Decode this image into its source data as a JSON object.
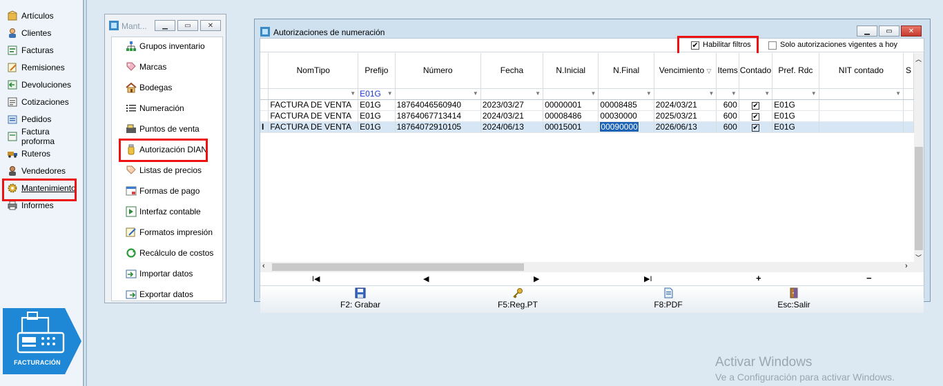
{
  "sidebar": {
    "items": [
      {
        "label": "Artículos",
        "icon": "box-icon"
      },
      {
        "label": "Clientes",
        "icon": "person-icon"
      },
      {
        "label": "Facturas",
        "icon": "invoice-icon"
      },
      {
        "label": "Remisiones",
        "icon": "note-icon"
      },
      {
        "label": "Devoluciones",
        "icon": "return-icon"
      },
      {
        "label": "Cotizaciones",
        "icon": "quote-icon"
      },
      {
        "label": "Pedidos",
        "icon": "order-icon"
      },
      {
        "label": "Factura proforma",
        "icon": "proforma-icon"
      },
      {
        "label": "Ruteros",
        "icon": "truck-icon"
      },
      {
        "label": "Vendedores",
        "icon": "seller-icon"
      },
      {
        "label": "Mantenimiento",
        "icon": "gear-icon"
      },
      {
        "label": "Informes",
        "icon": "printer-icon"
      }
    ],
    "logo_text": "FACTURACIÓN"
  },
  "maint_panel": {
    "title": "Mant...",
    "items": [
      {
        "label": "Grupos inventario",
        "icon": "tree-icon"
      },
      {
        "label": "Marcas",
        "icon": "tag-icon"
      },
      {
        "label": "Bodegas",
        "icon": "house-icon"
      },
      {
        "label": "Numeración",
        "icon": "list-icon"
      },
      {
        "label": "Puntos de venta",
        "icon": "register-icon"
      },
      {
        "label": "Autorización DIAN",
        "icon": "jar-icon"
      },
      {
        "label": "Listas de precios",
        "icon": "price-tag-icon"
      },
      {
        "label": "Formas de pago",
        "icon": "payment-icon"
      },
      {
        "label": "Interfaz contable",
        "icon": "interface-icon"
      },
      {
        "label": "Formatos impresión",
        "icon": "format-icon"
      },
      {
        "label": "Recálculo de costos",
        "icon": "recalc-icon"
      },
      {
        "label": "Importar datos",
        "icon": "import-icon"
      },
      {
        "label": "Exportar datos",
        "icon": "export-icon"
      }
    ]
  },
  "window": {
    "title": "Autorizaciones de numeración",
    "filters": {
      "habilitar_label": "Habilitar filtros",
      "habilitar_checked": true,
      "vigentes_label": "Solo autorizaciones vigentes a hoy",
      "vigentes_checked": false
    },
    "columns": [
      "NomTipo",
      "Prefijo",
      "Número",
      "Fecha",
      "N.Inicial",
      "N.Final",
      "Vencimiento",
      "Items",
      "Contado",
      "Pref. Rdc",
      "NIT contado",
      "S"
    ],
    "filter_row": {
      "prefijo": "E01G"
    },
    "rows": [
      [
        "FACTURA DE VENTA",
        "E01G",
        "18764046560940",
        "2023/03/27",
        "00000001",
        "00008485",
        "2024/03/21",
        "600",
        "✔",
        "E01G",
        ""
      ],
      [
        "FACTURA DE VENTA",
        "E01G",
        "18764067713414",
        "2024/03/21",
        "00008486",
        "00030000",
        "2025/03/21",
        "600",
        "✔",
        "E01G",
        ""
      ],
      [
        "FACTURA DE VENTA",
        "E01G",
        "18764072910105",
        "2024/06/13",
        "00015001",
        "00090000",
        "2026/06/13",
        "600",
        "✔",
        "E01G",
        ""
      ]
    ],
    "row_indicator": "I",
    "nav": {
      "first": "I◀",
      "prev": "◀",
      "next": "▶",
      "last": "▶I",
      "add": "+",
      "remove": "−"
    },
    "toolbar": {
      "save": "F2: Grabar",
      "regpt": "F5:Reg.PT",
      "pdf": "F8:PDF",
      "exit": "Esc:Salir"
    }
  },
  "watermark": {
    "line1": "Activar Windows",
    "line2": "Ve a Configuración para activar Windows."
  }
}
